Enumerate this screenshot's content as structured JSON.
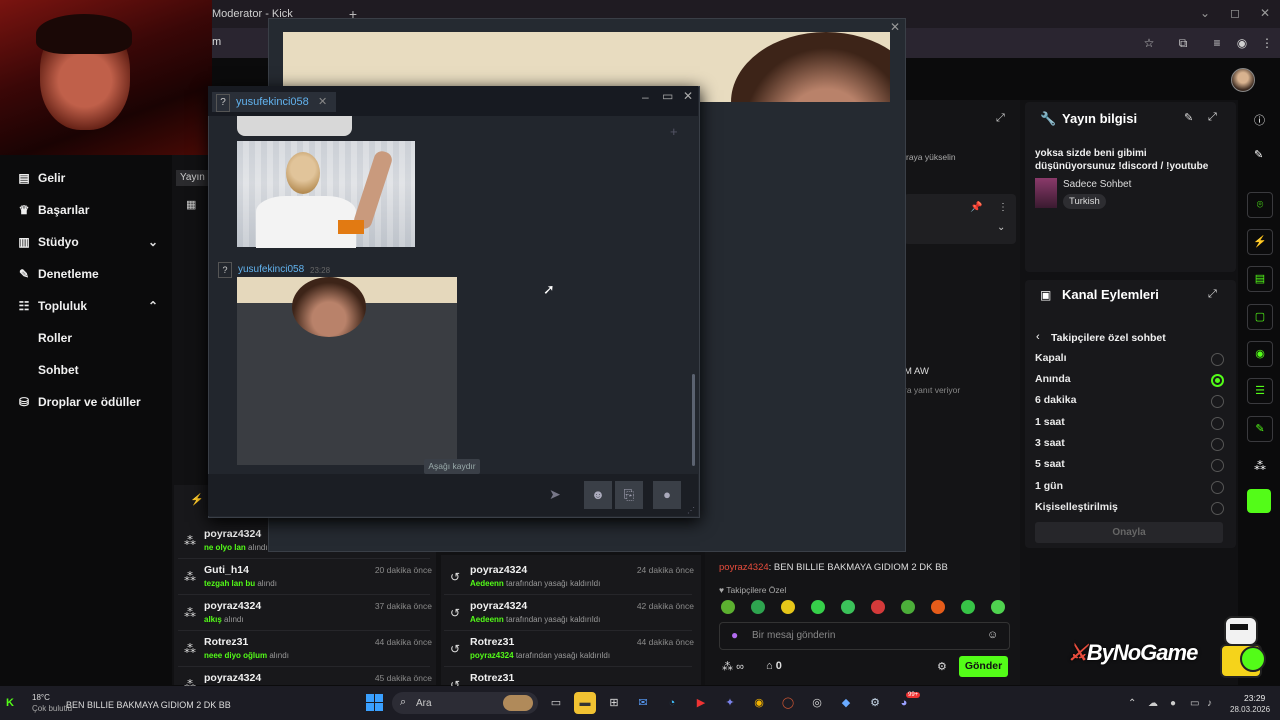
{
  "browser": {
    "tab_title": "Moderator - Kick Dashboard",
    "new_tab": "+",
    "url": "m",
    "controls": [
      "–",
      "◻",
      "✕"
    ]
  },
  "sidebar": {
    "items": [
      {
        "label": "Gelir",
        "icon": "chart-icon"
      },
      {
        "label": "Başarılar",
        "icon": "trophy-icon"
      },
      {
        "label": "Stüdyo",
        "icon": "studio-icon"
      },
      {
        "label": "Denetleme",
        "icon": "wrench-icon"
      },
      {
        "label": "Topluluk",
        "icon": "community-icon"
      }
    ],
    "sub_items": [
      "Roller",
      "Sohbet"
    ],
    "drops": "Droplar ve ödüller",
    "tooltip": "Yayın"
  },
  "popup": {
    "tab_name": "yusufekinci058",
    "q": "?",
    "msg_author": "yusufekinci058",
    "msg_time": "23:28",
    "scroll_down": "Aşağı kaydır"
  },
  "bg_chat": {
    "fragment1": "raya yükselin",
    "fragment2": "M AW",
    "fragment3": "ra yanıt veriyor",
    "pinned_user": "poyraz4324",
    "pinned_text": ": BEN BILLIE BAKMAYA GIDIOM 2 DK BB",
    "followers_only": "Takipçilere Özel",
    "input_placeholder": "Bir mesaj gönderin",
    "infinity_count": "∞",
    "store_count": "0",
    "send": "Gönder"
  },
  "info_panel": {
    "title": "Yayın bilgisi",
    "title_text": "yoksa sizde beni gibimi düşünüyorsunuz !discord / !youtube",
    "category": "Sadece Sohbet",
    "language": "Turkish"
  },
  "actions_panel": {
    "title": "Kanal Eylemleri",
    "back_label": "Takipçilere özel sohbet",
    "options": [
      "Kapalı",
      "Anında",
      "6 dakika",
      "1 saat",
      "3 saat",
      "5 saat",
      "1 gün",
      "Kişiselleştirilmiş"
    ],
    "selected_index": 1,
    "confirm": "Onayla"
  },
  "left_list": [
    {
      "name": "poyraz4324",
      "green": "ne olyo lan",
      "sub": "alındı",
      "time": ""
    },
    {
      "name": "Guti_h14",
      "green": "tezgah lan bu",
      "sub": "alındı",
      "time": "20 dakika önce"
    },
    {
      "name": "poyraz4324",
      "green": "alkış",
      "sub": "alındı",
      "time": "37 dakika önce"
    },
    {
      "name": "Rotrez31",
      "green": "neee diyo oğlum",
      "sub": "alındı",
      "time": "44 dakika önce"
    },
    {
      "name": "poyraz4324",
      "green": "",
      "sub": "",
      "time": "45 dakika önce"
    }
  ],
  "mid_list": [
    {
      "name": "poyraz4324",
      "green": "Aedeenn",
      "sub": "tarafından yasağı kaldırıldı",
      "time": "24 dakika önce"
    },
    {
      "name": "poyraz4324",
      "green": "Aedeenn",
      "sub": "tarafından yasağı kaldırıldı",
      "time": "42 dakika önce"
    },
    {
      "name": "Rotrez31",
      "green": "poyraz4324",
      "sub": "tarafından yasağı kaldırıldı",
      "time": "44 dakika önce"
    },
    {
      "name": "Rotrez31",
      "green": "",
      "sub": "",
      "time": ""
    }
  ],
  "watermark": "ByNoGame",
  "taskbar": {
    "weather_temp": "18°C",
    "weather_desc": "Çok bulutlu",
    "ticker": "BEN BILLIE BAKMAYA GIDIOM 2 DK BB",
    "search": "Ara",
    "time": "23:29",
    "date": "28.03.2026",
    "badge": "99+"
  },
  "colors": {
    "accent": "#53fc18",
    "steam_blue": "#62b3ef"
  }
}
